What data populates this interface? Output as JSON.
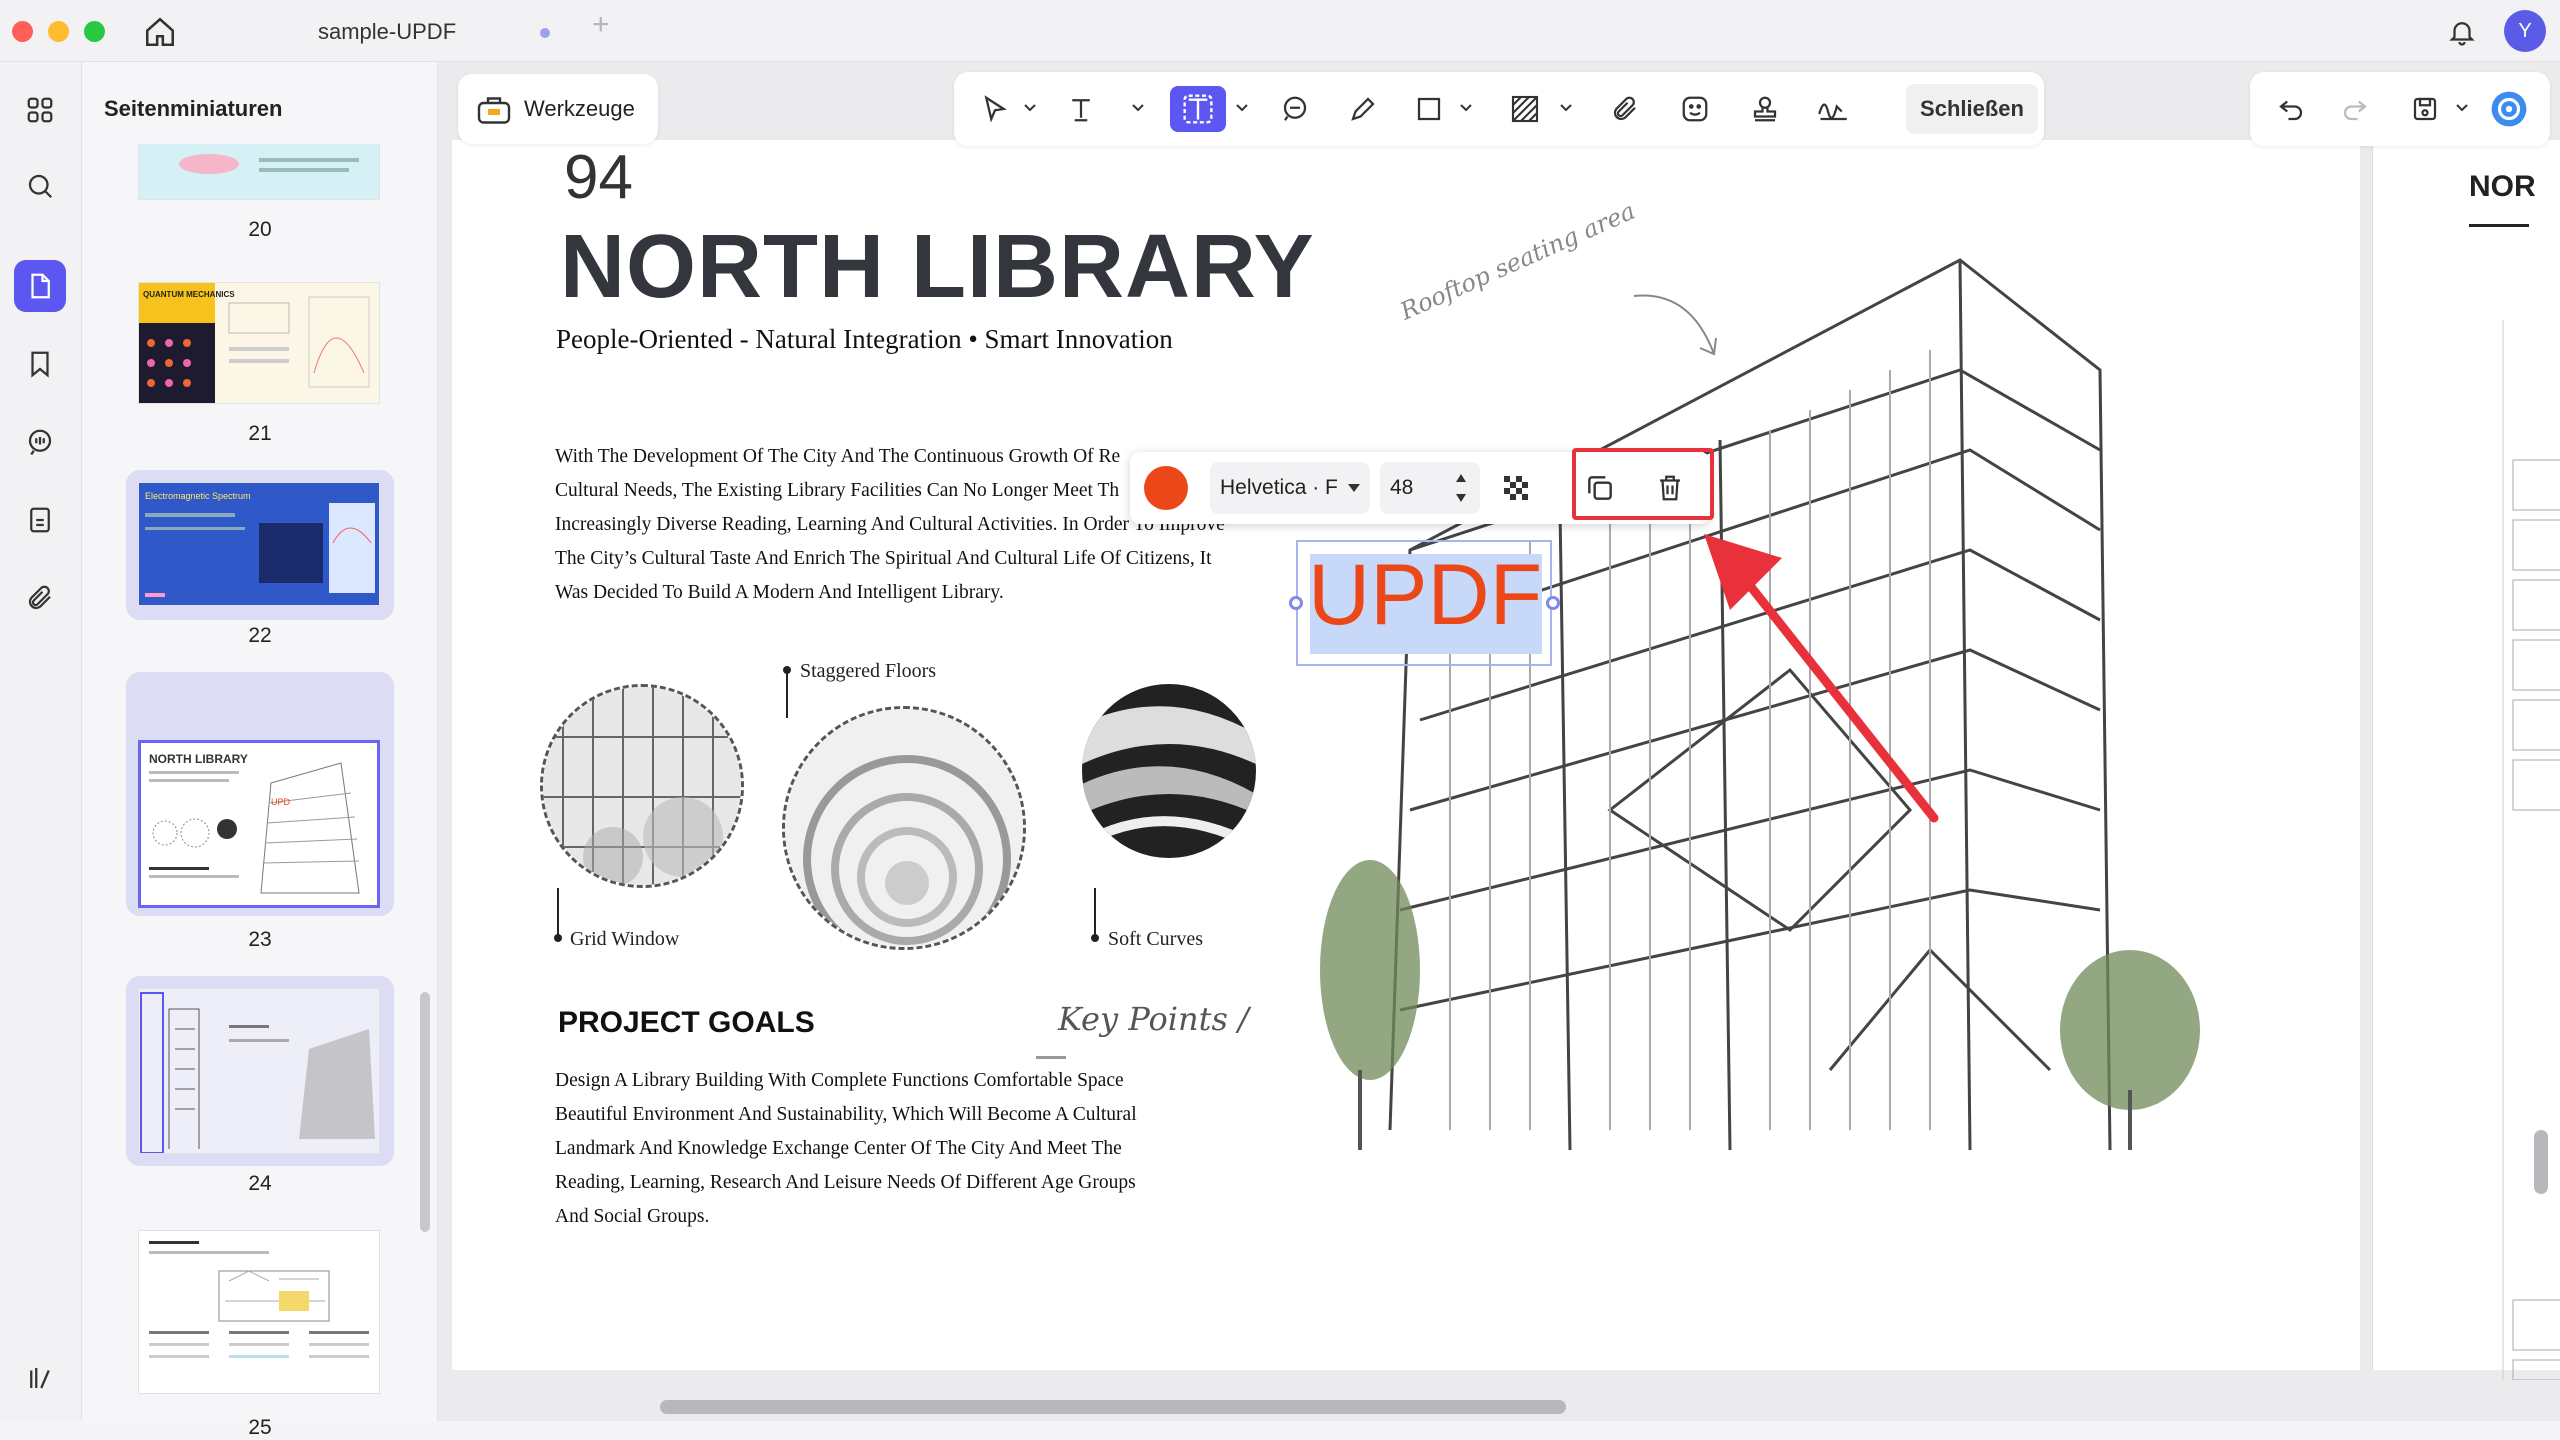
{
  "window": {
    "tab_title": "sample-UPDF",
    "tab_add": "+",
    "avatar_letter": "Y"
  },
  "sidebar": {
    "title": "Seitenminiaturen",
    "thumbnails": [
      {
        "page": "20"
      },
      {
        "page": "21",
        "label": "QUANTUM MECHANICS"
      },
      {
        "page": "22",
        "label": "Electromagnetic Spectrum"
      },
      {
        "page": "23",
        "label": "NORTH LIBRARY"
      },
      {
        "page": "24"
      },
      {
        "page": "25"
      }
    ]
  },
  "toolbar": {
    "werkzeuge": "Werkzeuge",
    "close": "Schließen"
  },
  "text_popover": {
    "color": "#ec4718",
    "font": "Helvetica · F",
    "size": "48"
  },
  "document": {
    "page_number": "94",
    "title": "NORTH LIBRARY",
    "subtitle": "People-Oriented - Natural Integration • Smart Innovation",
    "intro_lines": [
      "With The Development Of The City And The Continuous Growth Of Re",
      "Cultural Needs, The Existing Library Facilities Can No Longer Meet Th",
      "Increasingly Diverse Reading, Learning And Cultural Activities. In Order To Improve",
      "The City’s Cultural Taste And Enrich The Spiritual And Cultural Life Of Citizens, It",
      "Was Decided To Build A Modern And Intelligent Library."
    ],
    "rooftop_note": "Rooftop seating area",
    "caption_staggered": "Staggered Floors",
    "caption_grid": "Grid Window",
    "caption_curves": "Soft Curves",
    "goals_title": "PROJECT GOALS",
    "key_points": "Key Points /",
    "goals_lines": [
      "Design A Library Building With Complete Functions Comfortable Space",
      "Beautiful Environment And Sustainability, Which Will Become A Cultural",
      "Landmark And Knowledge Exchange Center Of The City And Meet The",
      "Reading, Learning, Research And Leisure Needs Of Different Age Groups",
      "And Social Groups."
    ],
    "inserted_text": "UPDF",
    "next_page_heading": "NOR"
  },
  "colors": {
    "accent": "#5b57f0",
    "text_color": "#ec4718",
    "highlight": "#e8313a"
  }
}
